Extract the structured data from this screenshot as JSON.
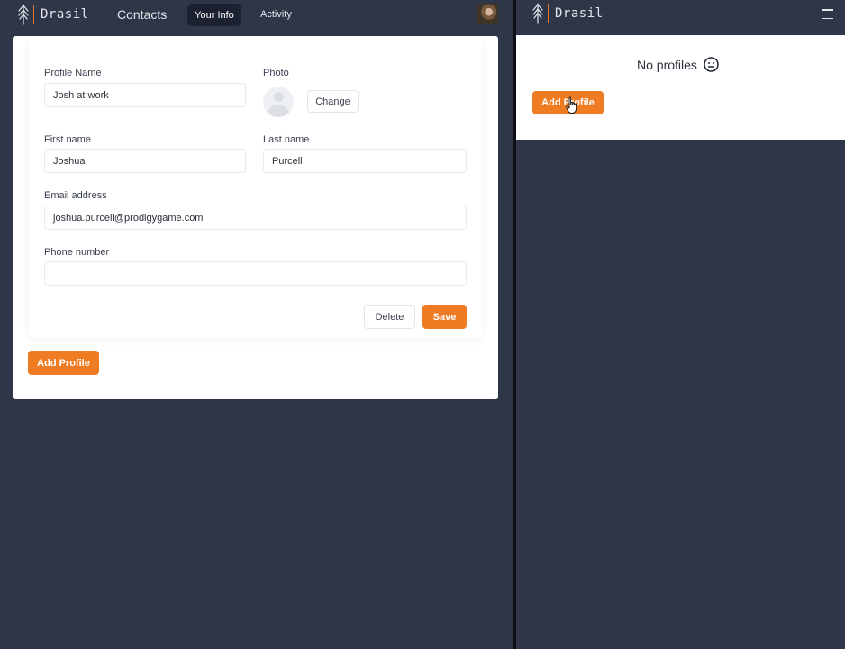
{
  "brand": {
    "name": "Drasil",
    "accent": "#e8742a"
  },
  "left": {
    "nav": {
      "contacts": "Contacts",
      "your_info": "Your Info",
      "activity": "Activity",
      "avatar_icon": "user-photo"
    },
    "form": {
      "profile_name_label": "Profile Name",
      "profile_name_value": "Josh at work",
      "photo_label": "Photo",
      "change_label": "Change",
      "first_name_label": "First name",
      "first_name_value": "Joshua",
      "last_name_label": "Last name",
      "last_name_value": "Purcell",
      "email_label": "Email address",
      "email_value": "joshua.purcell@prodigygame.com",
      "phone_label": "Phone number",
      "phone_value": "",
      "delete_label": "Delete",
      "save_label": "Save"
    },
    "add_profile_label": "Add Profile"
  },
  "right": {
    "empty_text": "No profiles",
    "empty_icon": "smiley-face",
    "add_profile_label": "Add Profile",
    "menu_icon": "hamburger-menu"
  },
  "colors": {
    "background": "#2e3647",
    "orange": "#ef7b22",
    "active_tab": "#1b2130"
  }
}
